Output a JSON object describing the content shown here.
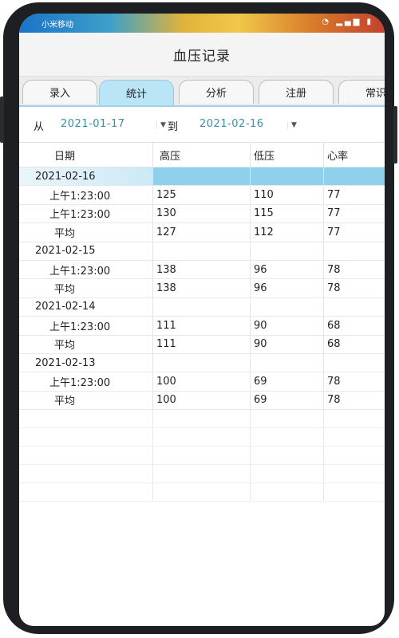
{
  "status_bar": {
    "carrier": "小米移动",
    "icons": "◔ ▂▄▆ ▮"
  },
  "app": {
    "title": "血压记录"
  },
  "tabs": [
    {
      "label": "录入",
      "active": false
    },
    {
      "label": "统计",
      "active": true
    },
    {
      "label": "分析",
      "active": false
    },
    {
      "label": "注册",
      "active": false
    },
    {
      "label": "常识",
      "active": false
    }
  ],
  "date_range": {
    "from_label": "从",
    "from_value": "2021-01-17",
    "to_label": "到",
    "to_value": "2021-02-16",
    "dropdown_glyph": "▼"
  },
  "table": {
    "headers": [
      "日期",
      "高压",
      "低压",
      "心率"
    ],
    "rows": [
      {
        "type": "group",
        "date": "2021-02-16",
        "selected": true
      },
      {
        "type": "item",
        "label": "上午1:23:00",
        "sys": "125",
        "dia": "110",
        "hr": "77"
      },
      {
        "type": "item",
        "label": "上午1:23:00",
        "sys": "130",
        "dia": "115",
        "hr": "77"
      },
      {
        "type": "avg",
        "label": "平均",
        "sys": "127",
        "dia": "112",
        "hr": "77"
      },
      {
        "type": "group",
        "date": "2021-02-15"
      },
      {
        "type": "item",
        "label": "上午1:23:00",
        "sys": "138",
        "dia": "96",
        "hr": "78"
      },
      {
        "type": "avg",
        "label": "平均",
        "sys": "138",
        "dia": "96",
        "hr": "78"
      },
      {
        "type": "group",
        "date": "2021-02-14"
      },
      {
        "type": "item",
        "label": "上午1:23:00",
        "sys": "111",
        "dia": "90",
        "hr": "68"
      },
      {
        "type": "avg",
        "label": "平均",
        "sys": "111",
        "dia": "90",
        "hr": "68"
      },
      {
        "type": "group",
        "date": "2021-02-13"
      },
      {
        "type": "item",
        "label": "上午1:23:00",
        "sys": "100",
        "dia": "69",
        "hr": "78"
      },
      {
        "type": "avg",
        "label": "平均",
        "sys": "100",
        "dia": "69",
        "hr": "78"
      }
    ]
  },
  "colors": {
    "accent": "#3a8fa8",
    "selected_row": "#8fd0ec",
    "active_tab": "#b9e5f6"
  }
}
